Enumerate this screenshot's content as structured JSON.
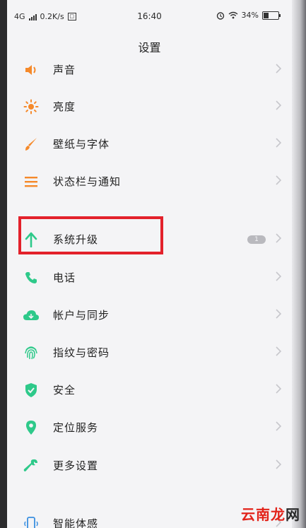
{
  "status_bar": {
    "network": "4G",
    "speed": "0.2K/s",
    "time": "16:40",
    "battery_percent": "34%",
    "battery_level": 0.34
  },
  "header": {
    "title": "设置"
  },
  "settings": [
    {
      "label": "声音",
      "icon": "speaker-icon",
      "color": "#f5892a"
    },
    {
      "label": "亮度",
      "icon": "sun-icon",
      "color": "#f5892a"
    },
    {
      "label": "壁纸与字体",
      "icon": "brush-icon",
      "color": "#f5892a"
    },
    {
      "label": "状态栏与通知",
      "icon": "list-icon",
      "color": "#f5892a"
    },
    {
      "label": "系统升级",
      "icon": "arrow-up-icon",
      "color": "#2ec98a",
      "badge": "1"
    },
    {
      "label": "电话",
      "icon": "phone-icon",
      "color": "#2ec98a"
    },
    {
      "label": "帐户与同步",
      "icon": "cloud-icon",
      "color": "#2ec98a"
    },
    {
      "label": "指纹与密码",
      "icon": "fingerprint-icon",
      "color": "#2ec98a"
    },
    {
      "label": "安全",
      "icon": "shield-icon",
      "color": "#2ec98a"
    },
    {
      "label": "定位服务",
      "icon": "location-pin-icon",
      "color": "#2ec98a"
    },
    {
      "label": "更多设置",
      "icon": "wrench-icon",
      "color": "#2ec98a"
    },
    {
      "label": "智能体感",
      "icon": "phone-motion-icon",
      "color": "#3a8fe0"
    }
  ],
  "watermark": {
    "text_red": "云南龙",
    "text_dark": "网"
  }
}
